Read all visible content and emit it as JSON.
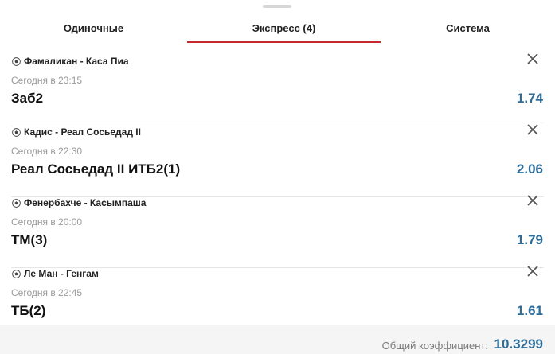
{
  "tabs": [
    {
      "label": "Одиночные",
      "active": false
    },
    {
      "label": "Экспресс (4)",
      "active": true
    },
    {
      "label": "Система",
      "active": false
    }
  ],
  "bets": [
    {
      "match": "Фамаликан - Каса Пиа",
      "time": "Сегодня в 23:15",
      "outcome": "Заб2",
      "odds": "1.74",
      "sport_icon": "soccer-ball-icon"
    },
    {
      "match": "Кадис - Реал Сосьедад II",
      "time": "Сегодня в 22:30",
      "outcome": "Реал Сосьедад II ИТБ2(1)",
      "odds": "2.06",
      "sport_icon": "soccer-ball-icon"
    },
    {
      "match": "Фенербахче - Касымпаша",
      "time": "Сегодня в 20:00",
      "outcome": "ТМ(3)",
      "odds": "1.79",
      "sport_icon": "soccer-ball-icon"
    },
    {
      "match": "Ле Ман - Генгам",
      "time": "Сегодня в 22:45",
      "outcome": "ТБ(2)",
      "odds": "1.61",
      "sport_icon": "soccer-ball-icon"
    }
  ],
  "footer": {
    "total_label": "Общий коэффициент:",
    "total_value": "10.3299"
  },
  "colors": {
    "accent": "#c8282d",
    "odds": "#2f6d99"
  }
}
